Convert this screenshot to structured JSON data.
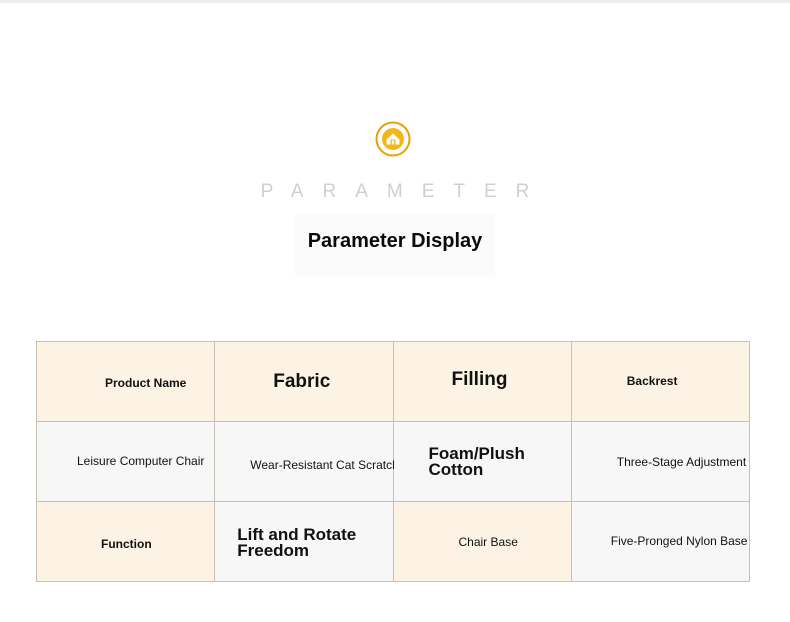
{
  "header": {
    "icon": "home-icon",
    "accent_color": "#e8a200",
    "eyebrow": "PARAMETER",
    "title": "Parameter Display"
  },
  "table": {
    "rows": [
      [
        "Product Name",
        "Fabric",
        "Filling",
        "Backrest"
      ],
      [
        "Leisure Computer Chair",
        "Wear-Resistant Cat Scratch Leather",
        "Foam/Plush Cotton",
        "Three-Stage Adjustment"
      ],
      [
        "Function",
        "Lift and Rotate Freedom",
        "Chair Base",
        "Five-Pronged Nylon Base"
      ]
    ],
    "colors": {
      "cream": "#fdf3e5",
      "grey": "#f7f7f7",
      "border": "#c9c0b5"
    }
  }
}
